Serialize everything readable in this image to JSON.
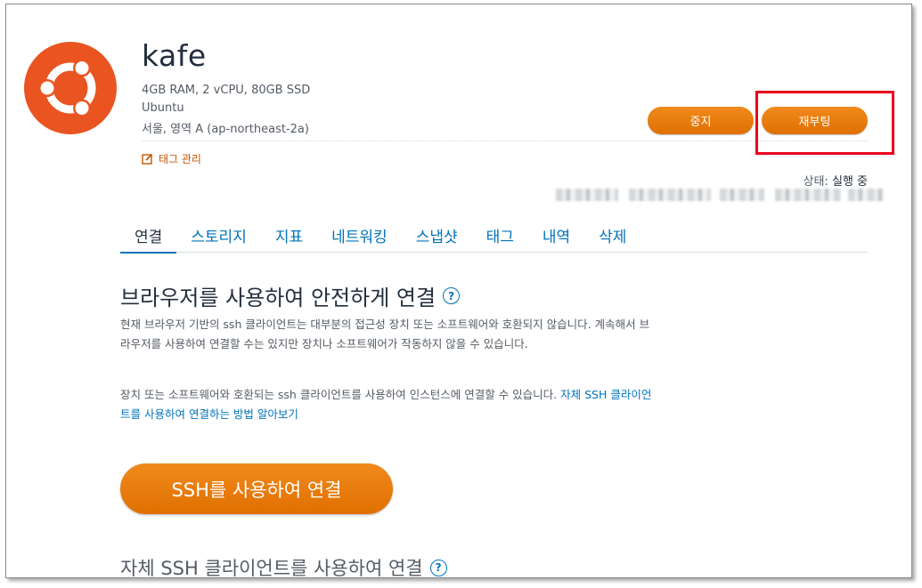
{
  "instance": {
    "name": "kafe",
    "spec": "4GB RAM, 2 vCPU, 80GB SSD",
    "os": "Ubuntu",
    "region": "서울, 영역 A (ap-northeast-2a)",
    "tag_manage": "태그 관리"
  },
  "actions": {
    "stop": "중지",
    "reboot": "재부팅"
  },
  "status": {
    "label": "상태: ",
    "value": "실행 중"
  },
  "tabs": [
    {
      "label": "연결",
      "active": true
    },
    {
      "label": "스토리지"
    },
    {
      "label": "지표"
    },
    {
      "label": "네트워킹"
    },
    {
      "label": "스냅샷"
    },
    {
      "label": "태그"
    },
    {
      "label": "내역"
    },
    {
      "label": "삭제"
    }
  ],
  "connect": {
    "title": "브라우저를 사용하여 안전하게 연결",
    "help": "?",
    "para1": "현재 브라우저 기반의 ssh 클라이언트는 대부분의 접근성 장치 또는 소프트웨어와 호환되지 않습니다. 계속해서 브라우저를 사용하여 연결할 수는 있지만 장치나 소프트웨어가 작동하지 않을 수 있습니다.",
    "para2": "장치 또는 소프트웨어와 호환되는 ssh 클라이언트를 사용하여 인스턴스에 연결할 수 있습니다. ",
    "para2_link": "자체 SSH 클라이언트를 사용하여 연결하는 방법 알아보기",
    "ssh_button": "SSH를 사용하여 연결",
    "title2": "자체 SSH 클라이언트를 사용하여 연결"
  },
  "colors": {
    "accent_orange": "#ec7211",
    "brand_ubuntu": "#e95420",
    "link_blue": "#0073bb",
    "highlight_red": "#e8001c"
  }
}
